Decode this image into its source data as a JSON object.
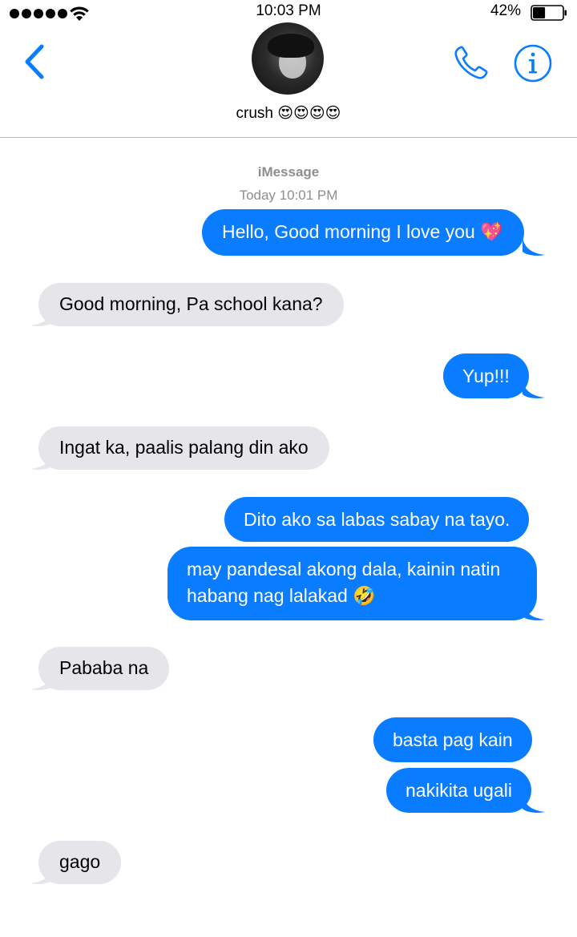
{
  "status_bar": {
    "time": "10:03 PM",
    "battery_percent": "42%",
    "battery_level": 0.42,
    "signal_bars": 5,
    "icons": [
      "signal-dots-icon",
      "wifi-icon",
      "battery-icon"
    ]
  },
  "header": {
    "back_icon": "chevron-left-icon",
    "contact_name": "crush",
    "contact_emojis": "😍😍😍😍",
    "call_icon": "phone-icon",
    "info_icon": "info-icon",
    "accent_color": "#0a7cff"
  },
  "thread": {
    "service": "iMessage",
    "timestamp": "Today 10:01 PM",
    "messages": [
      {
        "direction": "outgoing",
        "text": "Hello, Good morning I love you",
        "emoji": "💖"
      },
      {
        "direction": "incoming",
        "text": "Good morning, Pa school kana?"
      },
      {
        "direction": "outgoing",
        "text": "Yup!!!"
      },
      {
        "direction": "incoming",
        "text": "Ingat ka, paalis palang din ako"
      },
      {
        "direction": "outgoing",
        "text": "Dito ako sa labas sabay na tayo."
      },
      {
        "direction": "outgoing",
        "text_line1": "may pandesal akong dala, kainin natin",
        "text_line2": "habang nag lalakad",
        "emoji": "🤣"
      },
      {
        "direction": "incoming",
        "text": "Pababa na"
      },
      {
        "direction": "outgoing",
        "text": "basta pag kain"
      },
      {
        "direction": "outgoing",
        "text": "nakikita ugali"
      },
      {
        "direction": "incoming",
        "text": "gago"
      }
    ],
    "colors": {
      "outgoing_bubble": "#0a7cff",
      "incoming_bubble": "#e6e5ea"
    }
  }
}
